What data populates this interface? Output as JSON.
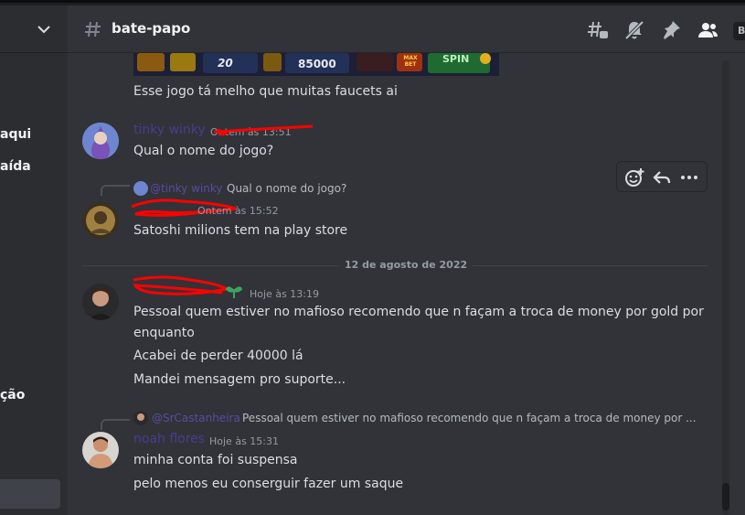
{
  "sidebar": {
    "items": [
      {
        "label": "aqui"
      },
      {
        "label": "aída"
      },
      {
        "label": "ção"
      }
    ]
  },
  "header": {
    "channel_name": "bate-papo",
    "box_letter": "B"
  },
  "game_image": {
    "tiles": [
      "20",
      "85000",
      "MAX BET",
      "SPIN"
    ]
  },
  "messages": {
    "m0": {
      "text": "Esse jogo tá melho que muitas faucets ai"
    },
    "m1": {
      "username": "tinky winky",
      "timestamp": "Ontem às 13:51",
      "text": "Qual o nome do jogo?"
    },
    "m2": {
      "reply_name": "@tinky winky",
      "reply_text": "Qual o nome do jogo?",
      "timestamp": "Ontem às 15:52",
      "text": "Satoshi milions  tem na play store"
    },
    "m3": {
      "timestamp": "Hoje às 13:19",
      "text1": "Pessoal quem estiver no mafioso recomendo que n façam a troca de money por gold por",
      "text1b": "enquanto",
      "text2": "Acabei de perder 40000 lá",
      "text3": "Mandei mensagem pro suporte..."
    },
    "m4": {
      "reply_name": "@SrCastanheira",
      "reply_text": "Pessoal quem estiver no mafioso recomendo que n façam a troca de money por ...",
      "username": "noah flores",
      "timestamp": "Hoje às 15:31",
      "text1": "minha conta foi suspensa",
      "text2": "pelo menos eu conserguir fazer um saque"
    }
  },
  "date_divider": "12 de agosto de 2022",
  "colors": {
    "background": "#313338",
    "sidebar": "#2b2d31",
    "username_purple": "#4b3b8f",
    "redaction": "#ff0000"
  }
}
